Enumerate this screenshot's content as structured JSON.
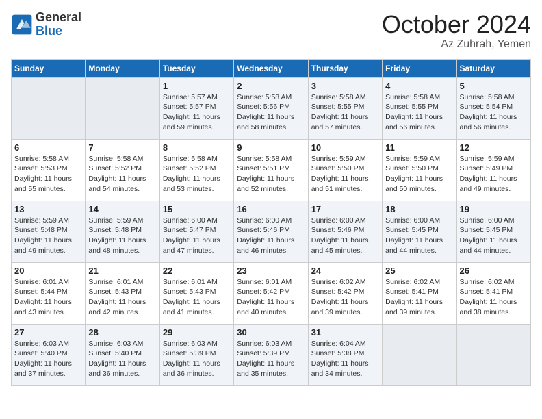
{
  "logo": {
    "general": "General",
    "blue": "Blue"
  },
  "title": "October 2024",
  "location": "Az Zuhrah, Yemen",
  "weekdays": [
    "Sunday",
    "Monday",
    "Tuesday",
    "Wednesday",
    "Thursday",
    "Friday",
    "Saturday"
  ],
  "weeks": [
    [
      {
        "day": "",
        "info": ""
      },
      {
        "day": "",
        "info": ""
      },
      {
        "day": "1",
        "info": "Sunrise: 5:57 AM\nSunset: 5:57 PM\nDaylight: 11 hours and 59 minutes."
      },
      {
        "day": "2",
        "info": "Sunrise: 5:58 AM\nSunset: 5:56 PM\nDaylight: 11 hours and 58 minutes."
      },
      {
        "day": "3",
        "info": "Sunrise: 5:58 AM\nSunset: 5:55 PM\nDaylight: 11 hours and 57 minutes."
      },
      {
        "day": "4",
        "info": "Sunrise: 5:58 AM\nSunset: 5:55 PM\nDaylight: 11 hours and 56 minutes."
      },
      {
        "day": "5",
        "info": "Sunrise: 5:58 AM\nSunset: 5:54 PM\nDaylight: 11 hours and 56 minutes."
      }
    ],
    [
      {
        "day": "6",
        "info": "Sunrise: 5:58 AM\nSunset: 5:53 PM\nDaylight: 11 hours and 55 minutes."
      },
      {
        "day": "7",
        "info": "Sunrise: 5:58 AM\nSunset: 5:52 PM\nDaylight: 11 hours and 54 minutes."
      },
      {
        "day": "8",
        "info": "Sunrise: 5:58 AM\nSunset: 5:52 PM\nDaylight: 11 hours and 53 minutes."
      },
      {
        "day": "9",
        "info": "Sunrise: 5:58 AM\nSunset: 5:51 PM\nDaylight: 11 hours and 52 minutes."
      },
      {
        "day": "10",
        "info": "Sunrise: 5:59 AM\nSunset: 5:50 PM\nDaylight: 11 hours and 51 minutes."
      },
      {
        "day": "11",
        "info": "Sunrise: 5:59 AM\nSunset: 5:50 PM\nDaylight: 11 hours and 50 minutes."
      },
      {
        "day": "12",
        "info": "Sunrise: 5:59 AM\nSunset: 5:49 PM\nDaylight: 11 hours and 49 minutes."
      }
    ],
    [
      {
        "day": "13",
        "info": "Sunrise: 5:59 AM\nSunset: 5:48 PM\nDaylight: 11 hours and 49 minutes."
      },
      {
        "day": "14",
        "info": "Sunrise: 5:59 AM\nSunset: 5:48 PM\nDaylight: 11 hours and 48 minutes."
      },
      {
        "day": "15",
        "info": "Sunrise: 6:00 AM\nSunset: 5:47 PM\nDaylight: 11 hours and 47 minutes."
      },
      {
        "day": "16",
        "info": "Sunrise: 6:00 AM\nSunset: 5:46 PM\nDaylight: 11 hours and 46 minutes."
      },
      {
        "day": "17",
        "info": "Sunrise: 6:00 AM\nSunset: 5:46 PM\nDaylight: 11 hours and 45 minutes."
      },
      {
        "day": "18",
        "info": "Sunrise: 6:00 AM\nSunset: 5:45 PM\nDaylight: 11 hours and 44 minutes."
      },
      {
        "day": "19",
        "info": "Sunrise: 6:00 AM\nSunset: 5:45 PM\nDaylight: 11 hours and 44 minutes."
      }
    ],
    [
      {
        "day": "20",
        "info": "Sunrise: 6:01 AM\nSunset: 5:44 PM\nDaylight: 11 hours and 43 minutes."
      },
      {
        "day": "21",
        "info": "Sunrise: 6:01 AM\nSunset: 5:43 PM\nDaylight: 11 hours and 42 minutes."
      },
      {
        "day": "22",
        "info": "Sunrise: 6:01 AM\nSunset: 5:43 PM\nDaylight: 11 hours and 41 minutes."
      },
      {
        "day": "23",
        "info": "Sunrise: 6:01 AM\nSunset: 5:42 PM\nDaylight: 11 hours and 40 minutes."
      },
      {
        "day": "24",
        "info": "Sunrise: 6:02 AM\nSunset: 5:42 PM\nDaylight: 11 hours and 39 minutes."
      },
      {
        "day": "25",
        "info": "Sunrise: 6:02 AM\nSunset: 5:41 PM\nDaylight: 11 hours and 39 minutes."
      },
      {
        "day": "26",
        "info": "Sunrise: 6:02 AM\nSunset: 5:41 PM\nDaylight: 11 hours and 38 minutes."
      }
    ],
    [
      {
        "day": "27",
        "info": "Sunrise: 6:03 AM\nSunset: 5:40 PM\nDaylight: 11 hours and 37 minutes."
      },
      {
        "day": "28",
        "info": "Sunrise: 6:03 AM\nSunset: 5:40 PM\nDaylight: 11 hours and 36 minutes."
      },
      {
        "day": "29",
        "info": "Sunrise: 6:03 AM\nSunset: 5:39 PM\nDaylight: 11 hours and 36 minutes."
      },
      {
        "day": "30",
        "info": "Sunrise: 6:03 AM\nSunset: 5:39 PM\nDaylight: 11 hours and 35 minutes."
      },
      {
        "day": "31",
        "info": "Sunrise: 6:04 AM\nSunset: 5:38 PM\nDaylight: 11 hours and 34 minutes."
      },
      {
        "day": "",
        "info": ""
      },
      {
        "day": "",
        "info": ""
      }
    ]
  ]
}
